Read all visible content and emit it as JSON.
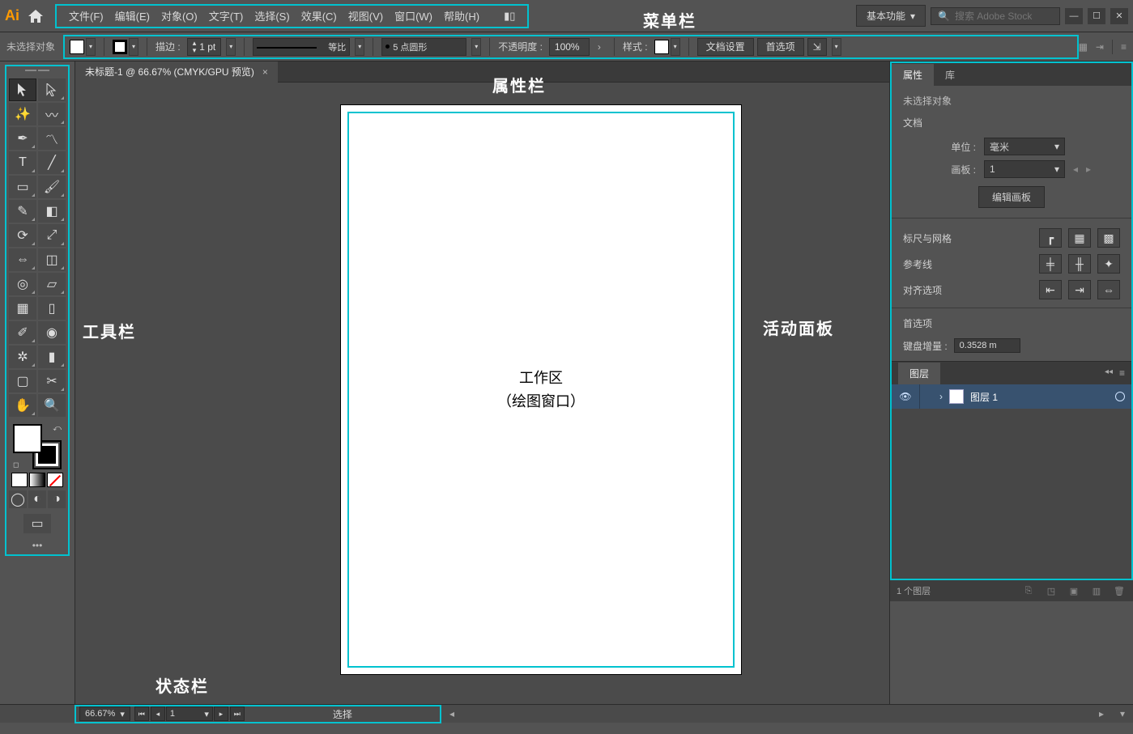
{
  "app": {
    "workspace_label": "基本功能",
    "search_placeholder": "搜索 Adobe Stock"
  },
  "menu": {
    "items": [
      "文件(F)",
      "编辑(E)",
      "对象(O)",
      "文字(T)",
      "选择(S)",
      "效果(C)",
      "视图(V)",
      "窗口(W)",
      "帮助(H)"
    ]
  },
  "options": {
    "no_selection": "未选择对象",
    "stroke_label": "描边 :",
    "stroke_weight": "1 pt",
    "width_profile": "等比",
    "brush": "5 点圆形",
    "opacity_label": "不透明度 :",
    "opacity_value": "100%",
    "style_label": "样式 :",
    "doc_setup": "文档设置",
    "prefs": "首选项"
  },
  "tab": {
    "title": "未标题-1 @ 66.67% (CMYK/GPU 预览)"
  },
  "artboard": {
    "line1": "工作区",
    "line2": "（绘图窗口）"
  },
  "status": {
    "zoom": "66.67%",
    "artboard_no": "1",
    "tool": "选择"
  },
  "props": {
    "tab_props": "属性",
    "tab_lib": "库",
    "no_selection": "未选择对象",
    "doc_section": "文档",
    "unit_label": "单位 :",
    "unit_value": "毫米",
    "artboard_label": "画板 :",
    "artboard_value": "1",
    "edit_artboard": "编辑画板",
    "ruler_grid": "标尺与网格",
    "guides": "参考线",
    "align": "对齐选项",
    "prefs": "首选项",
    "keyboard_inc_label": "键盘增量 :",
    "keyboard_inc_value": "0.3528 m"
  },
  "layers": {
    "tab": "图层",
    "row_name": "图层 1",
    "count": "1 个图层"
  },
  "annotations": {
    "menu": "菜单栏",
    "options": "属性栏",
    "tools": "工具栏",
    "panels": "活动面板",
    "status": "状态栏"
  }
}
